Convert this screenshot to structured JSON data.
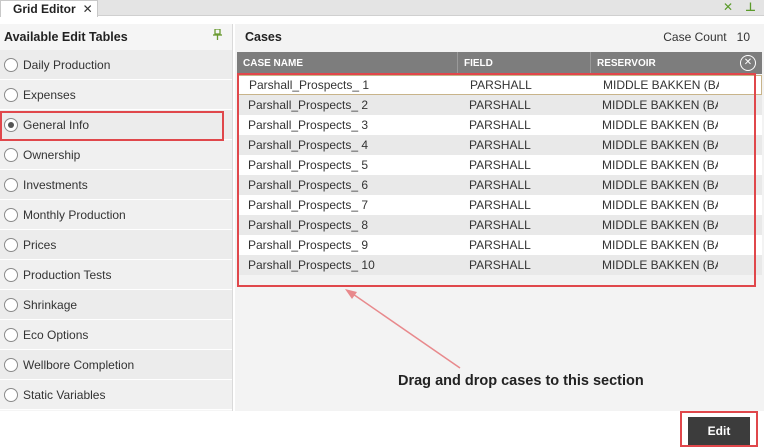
{
  "tab": {
    "title": "Grid Editor",
    "close_glyph": "✕"
  },
  "tabbar_icons": {
    "close": "✕",
    "pin": "⊥"
  },
  "left_panel": {
    "title": "Available Edit Tables",
    "pin_icon": "pin-icon",
    "items": [
      {
        "label": "Daily Production",
        "checked": false
      },
      {
        "label": "Expenses",
        "checked": false
      },
      {
        "label": "General Info",
        "checked": true
      },
      {
        "label": "Ownership",
        "checked": false
      },
      {
        "label": "Investments",
        "checked": false
      },
      {
        "label": "Monthly Production",
        "checked": false
      },
      {
        "label": "Prices",
        "checked": false
      },
      {
        "label": "Production Tests",
        "checked": false
      },
      {
        "label": "Shrinkage",
        "checked": false
      },
      {
        "label": "Eco Options",
        "checked": false
      },
      {
        "label": "Wellbore Completion",
        "checked": false
      },
      {
        "label": "Static Variables",
        "checked": false
      }
    ]
  },
  "cases": {
    "title": "Cases",
    "count_label": "Case Count",
    "count": "10",
    "columns": [
      "CASE NAME",
      "FIELD",
      "RESERVOIR"
    ],
    "clear_glyph": "✕",
    "rows": [
      [
        "Parshall_Prospects_ 1",
        "PARSHALL",
        "MIDDLE BAKKEN (BAKK"
      ],
      [
        "Parshall_Prospects_ 2",
        "PARSHALL",
        "MIDDLE BAKKEN (BAKK"
      ],
      [
        "Parshall_Prospects_ 3",
        "PARSHALL",
        "MIDDLE BAKKEN (BAKK"
      ],
      [
        "Parshall_Prospects_ 4",
        "PARSHALL",
        "MIDDLE BAKKEN (BAKK"
      ],
      [
        "Parshall_Prospects_ 5",
        "PARSHALL",
        "MIDDLE BAKKEN (BAKK"
      ],
      [
        "Parshall_Prospects_ 6",
        "PARSHALL",
        "MIDDLE BAKKEN (BAKK"
      ],
      [
        "Parshall_Prospects_ 7",
        "PARSHALL",
        "MIDDLE BAKKEN (BAKK"
      ],
      [
        "Parshall_Prospects_ 8",
        "PARSHALL",
        "MIDDLE BAKKEN (BAKK"
      ],
      [
        "Parshall_Prospects_ 9",
        "PARSHALL",
        "MIDDLE BAKKEN (BAKK"
      ],
      [
        "Parshall_Prospects_ 10",
        "PARSHALL",
        "MIDDLE BAKKEN (BAKK"
      ]
    ]
  },
  "annotation": {
    "text": "Drag and drop cases to this section",
    "color": "#e0474b"
  },
  "footer": {
    "edit_label": "Edit"
  }
}
